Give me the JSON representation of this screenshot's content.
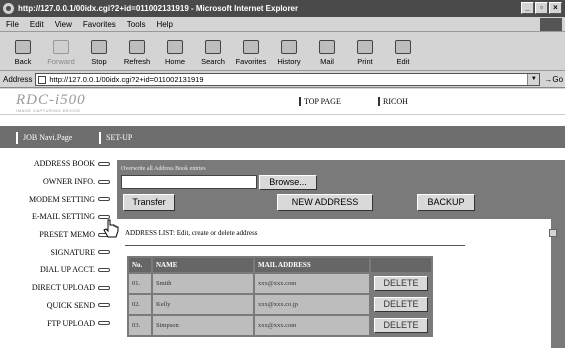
{
  "window": {
    "title": "http://127.0.0.1/00idx.cgi?2+id=011002131919 - Microsoft Internet Explorer",
    "buttons": [
      "_",
      "▫",
      "×"
    ]
  },
  "menu": [
    "File",
    "Edit",
    "View",
    "Favorites",
    "Tools",
    "Help"
  ],
  "toolbar": [
    {
      "label": "Back",
      "icon": "back-arrow-icon",
      "enabled": true
    },
    {
      "label": "Forward",
      "icon": "forward-arrow-icon",
      "enabled": false
    },
    {
      "label": "Stop",
      "icon": "stop-icon",
      "enabled": true
    },
    {
      "label": "Refresh",
      "icon": "refresh-icon",
      "enabled": true
    },
    {
      "label": "Home",
      "icon": "home-icon",
      "enabled": true
    },
    {
      "label": "Search",
      "icon": "search-icon",
      "enabled": true
    },
    {
      "label": "Favorites",
      "icon": "favorites-icon",
      "enabled": true
    },
    {
      "label": "History",
      "icon": "history-icon",
      "enabled": true
    },
    {
      "label": "Mail",
      "icon": "mail-icon",
      "enabled": true
    },
    {
      "label": "Print",
      "icon": "print-icon",
      "enabled": true
    },
    {
      "label": "Edit",
      "icon": "edit-icon",
      "enabled": true
    }
  ],
  "address": {
    "label": "Address",
    "value": "http://127.0.0.1/00idx.cgi?2+id=011002131919",
    "go": "Go"
  },
  "header": {
    "brand": "RDC-i500",
    "brand_sub": "IMAGE CAPTURING DEVICE",
    "links": [
      "TOP PAGE",
      "RICOH"
    ]
  },
  "nav": [
    "JOB Navi.Page",
    "SET-UP"
  ],
  "sidebar": [
    "ADDRESS BOOK",
    "OWNER INFO.",
    "MODEM SETTING",
    "E-MAIL SETTING",
    "PRESET MEMO",
    "SIGNATURE",
    "DIAL UP ACCT.",
    "DIRECT UPLOAD",
    "QUICK SEND",
    "FTP UPLOAD"
  ],
  "main": {
    "overwrite_label": "Overwrite all Address Book entries",
    "browse": "Browse...",
    "transfer": "Transfer",
    "new_address": "NEW ADDRESS",
    "backup": "BACKUP",
    "list_title": "ADDRESS LIST: Edit, create or delete address",
    "columns": [
      "No.",
      "NAME",
      "MAIL ADDRESS",
      ""
    ],
    "rows": [
      {
        "no": "01.",
        "name": "Smith",
        "mail": "xxx@xxx.com",
        "action": "DELETE"
      },
      {
        "no": "02.",
        "name": "Kelly",
        "mail": "xxx@xxx.co.jp",
        "action": "DELETE"
      },
      {
        "no": "03.",
        "name": "Simpson",
        "mail": "xxx@xxx.com",
        "action": "DELETE"
      }
    ]
  }
}
